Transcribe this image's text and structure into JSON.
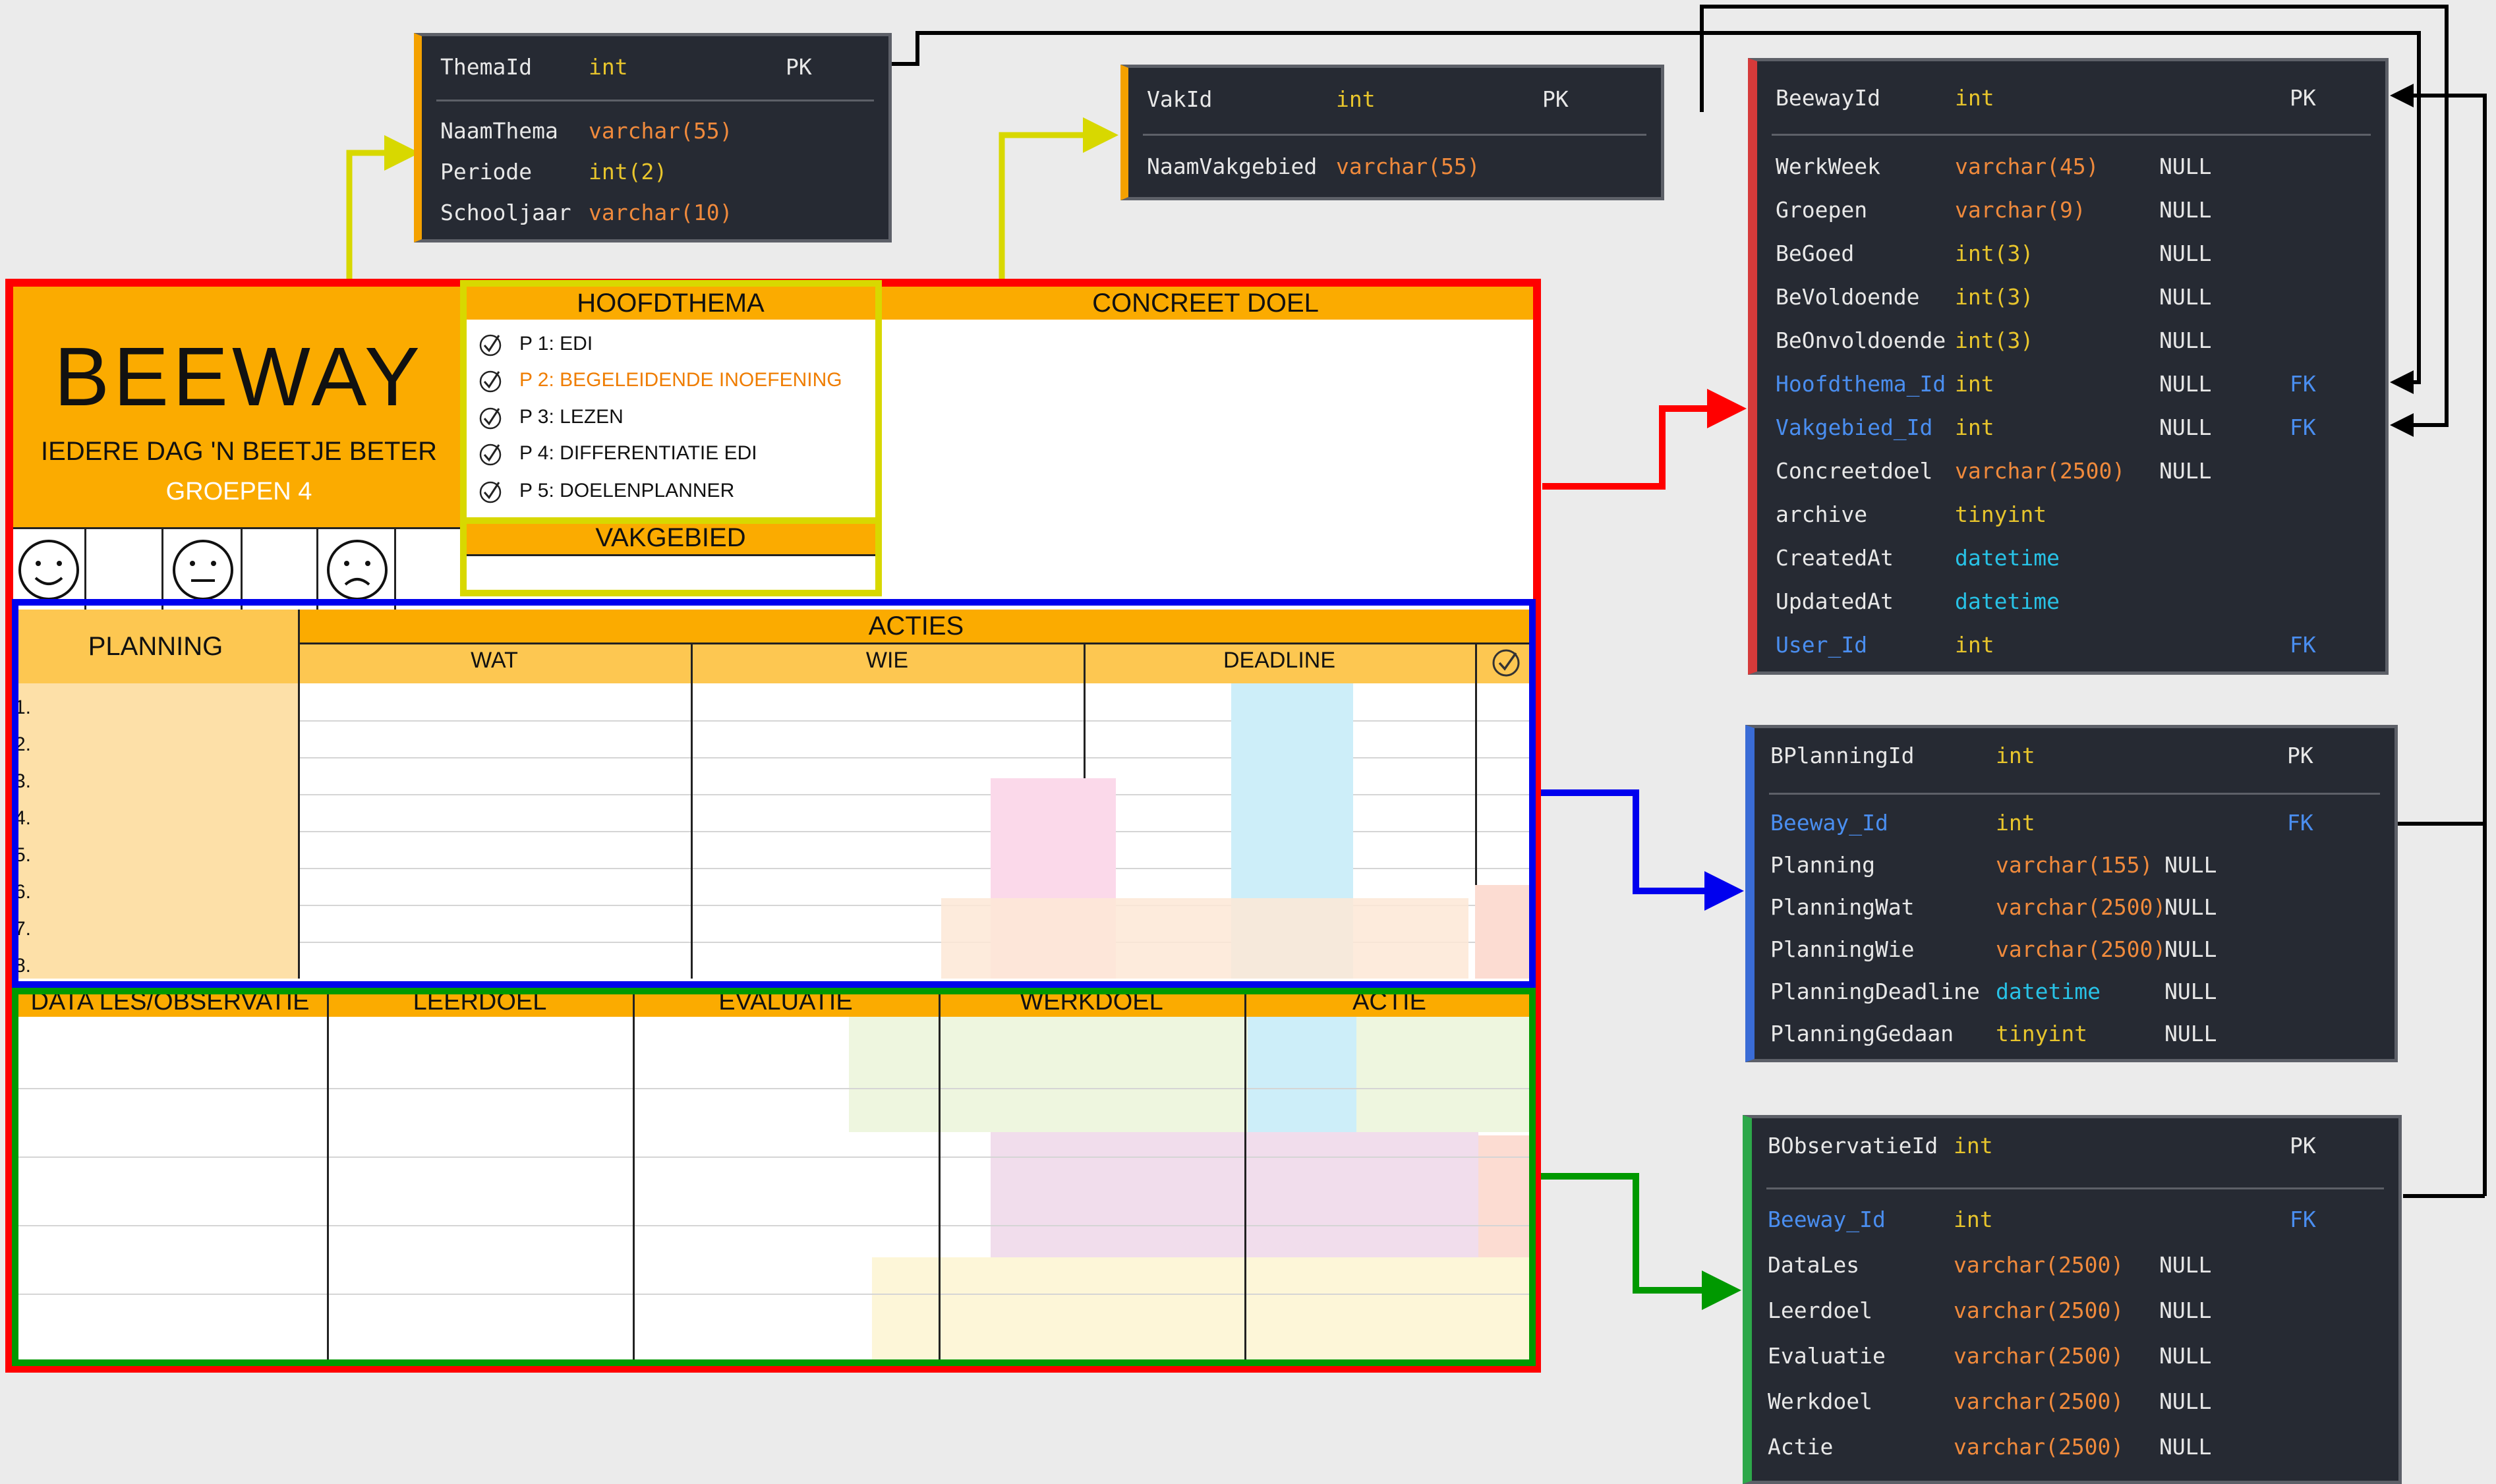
{
  "form": {
    "title": "BEEWAY",
    "slogan": "IEDERE DAG 'N BEETJE BETER",
    "group": "GROEPEN 4",
    "hoofdthema_header": "HOOFDTHEMA",
    "concreet_doel_header": "CONCREET DOEL",
    "vakgebied_header": "VAKGEBIED",
    "themes": [
      "P 1: EDI",
      "P 2: BEGELEIDENDE INOEFENING",
      "P 3: LEZEN",
      "P 4: DIFFERENTIATIE EDI",
      "P 5: DOELENPLANNER"
    ],
    "active_theme_index": 1,
    "planning_header": "PLANNING",
    "acties_header": "ACTIES",
    "acties_columns": [
      "WAT",
      "WIE",
      "DEADLINE"
    ],
    "row_numbers": [
      "1.",
      "2.",
      "3.",
      "4.",
      "5.",
      "6.",
      "7.",
      "8."
    ],
    "observatie_columns": [
      "DATA LES/OBSERVATIE",
      "LEERDOEL",
      "EVALUATIE",
      "WERKDOEL",
      "ACTIE"
    ],
    "smiley_icons": [
      "smiley-happy-icon",
      "smiley-neutral-icon",
      "smiley-sad-icon"
    ],
    "colors": {
      "orange": "#fbab00",
      "light_orange": "#fdc751",
      "peach": "#fde0a8",
      "active_theme": "#ef7d00"
    }
  },
  "tables": {
    "thema": [
      [
        "ThemaId",
        "int",
        "PK"
      ],
      [
        "NaamThema",
        "varchar(55)",
        ""
      ],
      [
        "Periode",
        "int(2)",
        ""
      ],
      [
        "Schooljaar",
        "varchar(10)",
        ""
      ]
    ],
    "vak": [
      [
        "VakId",
        "int",
        "PK"
      ],
      [
        "NaamVakgebied",
        "varchar(55)",
        ""
      ]
    ],
    "beeway": [
      [
        "BeewayId",
        "int",
        "",
        "PK"
      ],
      [
        "WerkWeek",
        "varchar(45)",
        "NULL",
        ""
      ],
      [
        "Groepen",
        "varchar(9)",
        "NULL",
        ""
      ],
      [
        "BeGoed",
        "int(3)",
        "NULL",
        ""
      ],
      [
        "BeVoldoende",
        "int(3)",
        "NULL",
        ""
      ],
      [
        "BeOnvoldoende",
        "int(3)",
        "NULL",
        ""
      ],
      [
        "Hoofdthema_Id",
        "int",
        "NULL",
        "FK"
      ],
      [
        "Vakgebied_Id",
        "int",
        "NULL",
        "FK"
      ],
      [
        "Concreetdoel",
        "varchar(2500)",
        "NULL",
        ""
      ],
      [
        "archive",
        "tinyint",
        "",
        ""
      ],
      [
        "CreatedAt",
        "datetime",
        "",
        ""
      ],
      [
        "UpdatedAt",
        "datetime",
        "",
        ""
      ],
      [
        "User_Id",
        "int",
        "",
        "FK"
      ]
    ],
    "bplanning": [
      [
        "BPlanningId",
        "int",
        "",
        "PK"
      ],
      [
        "Beeway_Id",
        "int",
        "",
        "FK"
      ],
      [
        "Planning",
        "varchar(155)",
        "NULL",
        ""
      ],
      [
        "PlanningWat",
        "varchar(2500)",
        "NULL",
        ""
      ],
      [
        "PlanningWie",
        "varchar(2500)",
        "NULL",
        ""
      ],
      [
        "PlanningDeadline",
        "datetime",
        "NULL",
        ""
      ],
      [
        "PlanningGedaan",
        "tinyint",
        "NULL",
        ""
      ]
    ],
    "bobservatie": [
      [
        "BObservatieId",
        "int",
        "",
        "PK"
      ],
      [
        "Beeway_Id",
        "int",
        "",
        "FK"
      ],
      [
        "DataLes",
        "varchar(2500)",
        "NULL",
        ""
      ],
      [
        "Leerdoel",
        "varchar(2500)",
        "NULL",
        ""
      ],
      [
        "Evaluatie",
        "varchar(2500)",
        "NULL",
        ""
      ],
      [
        "Werkdoel",
        "varchar(2500)",
        "NULL",
        ""
      ],
      [
        "Actie",
        "varchar(2500)",
        "NULL",
        ""
      ]
    ]
  },
  "connector_colors": {
    "thema": "#d8d800",
    "beeway": "#ff0000",
    "planning": "#0000ee",
    "observatie": "#009900",
    "fk": "#000000"
  }
}
